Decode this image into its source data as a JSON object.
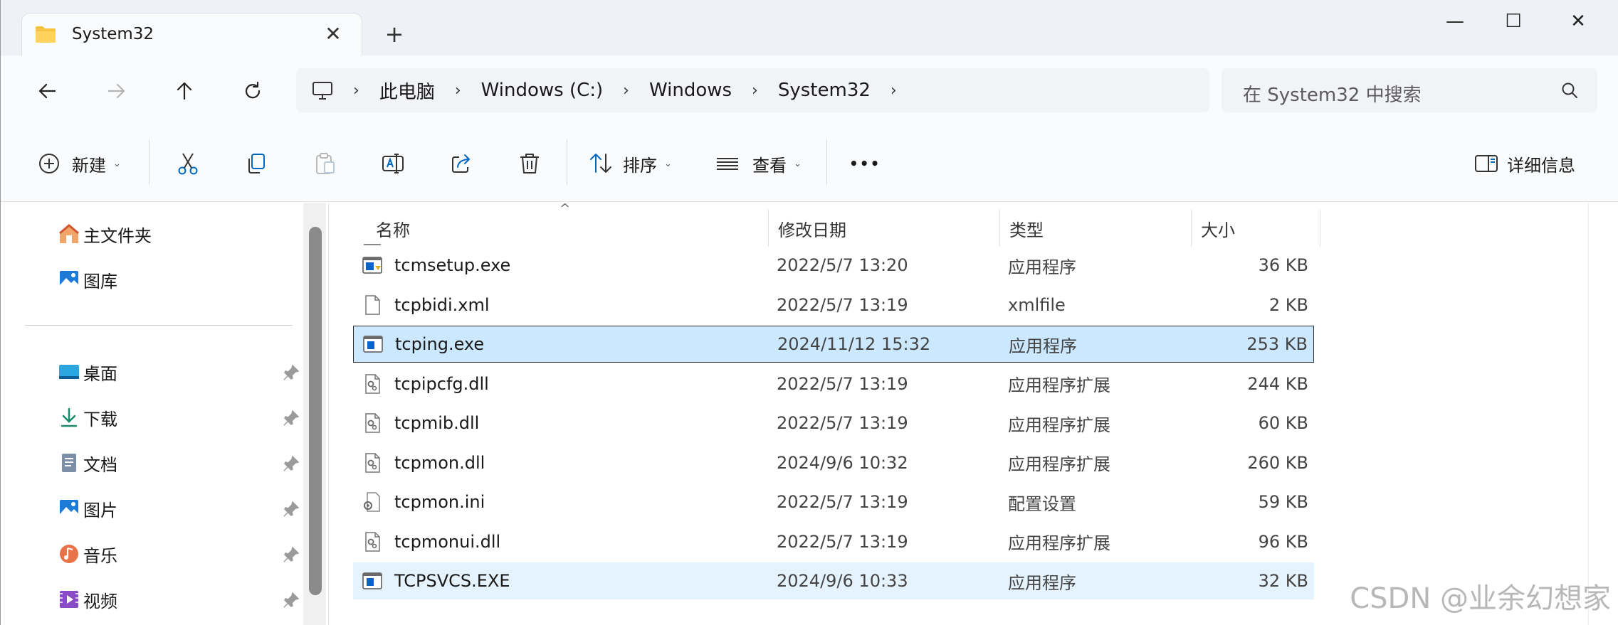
{
  "window": {
    "tab_title": "System32",
    "tab_close": "✕",
    "new_tab": "+",
    "minimize": "—",
    "maximize": "☐",
    "close": "✕"
  },
  "nav": {
    "breadcrumbs": [
      "此电脑",
      "Windows (C:)",
      "Windows",
      "System32"
    ],
    "separator": "›",
    "search_placeholder": "在 System32 中搜索"
  },
  "toolbar": {
    "new_label": "新建",
    "sort_label": "排序",
    "view_label": "查看",
    "more_label": "•••",
    "details_label": "详细信息",
    "caret": "⌄"
  },
  "sidebar": {
    "top_items": [
      {
        "label": "主文件夹",
        "icon": "home-icon"
      },
      {
        "label": "图库",
        "icon": "gallery-icon"
      }
    ],
    "pinned_items": [
      {
        "label": "桌面",
        "icon": "desktop-icon"
      },
      {
        "label": "下载",
        "icon": "download-icon"
      },
      {
        "label": "文档",
        "icon": "documents-icon"
      },
      {
        "label": "图片",
        "icon": "pictures-icon"
      },
      {
        "label": "音乐",
        "icon": "music-icon"
      },
      {
        "label": "视频",
        "icon": "videos-icon"
      }
    ]
  },
  "columns": {
    "name": "名称",
    "date": "修改日期",
    "type": "类型",
    "size": "大小",
    "sort_indicator": "^"
  },
  "files": [
    {
      "name": "tcmsetup.exe",
      "date": "2022/5/7 13:20",
      "type": "应用程序",
      "size": "36 KB",
      "icon": "installer-icon",
      "state": ""
    },
    {
      "name": "tcpbidi.xml",
      "date": "2022/5/7 13:19",
      "type": "xmlfile",
      "size": "2 KB",
      "icon": "file-icon",
      "state": ""
    },
    {
      "name": "tcping.exe",
      "date": "2024/11/12 15:32",
      "type": "应用程序",
      "size": "253 KB",
      "icon": "exe-icon",
      "state": "selected"
    },
    {
      "name": "tcpipcfg.dll",
      "date": "2022/5/7 13:19",
      "type": "应用程序扩展",
      "size": "244 KB",
      "icon": "dll-icon",
      "state": ""
    },
    {
      "name": "tcpmib.dll",
      "date": "2022/5/7 13:19",
      "type": "应用程序扩展",
      "size": "60 KB",
      "icon": "dll-icon",
      "state": ""
    },
    {
      "name": "tcpmon.dll",
      "date": "2024/9/6 10:32",
      "type": "应用程序扩展",
      "size": "260 KB",
      "icon": "dll-icon",
      "state": ""
    },
    {
      "name": "tcpmon.ini",
      "date": "2022/5/7 13:19",
      "type": "配置设置",
      "size": "59 KB",
      "icon": "ini-icon",
      "state": ""
    },
    {
      "name": "tcpmonui.dll",
      "date": "2022/5/7 13:19",
      "type": "应用程序扩展",
      "size": "96 KB",
      "icon": "dll-icon",
      "state": ""
    },
    {
      "name": "TCPSVCS.EXE",
      "date": "2024/9/6 10:33",
      "type": "应用程序",
      "size": "32 KB",
      "icon": "exe-icon",
      "state": "hover"
    }
  ],
  "watermark": "CSDN @业余幻想家",
  "colors": {
    "selected_bg": "#cce8ff",
    "hover_bg": "#e5f3ff",
    "accent": "#0067c0"
  }
}
